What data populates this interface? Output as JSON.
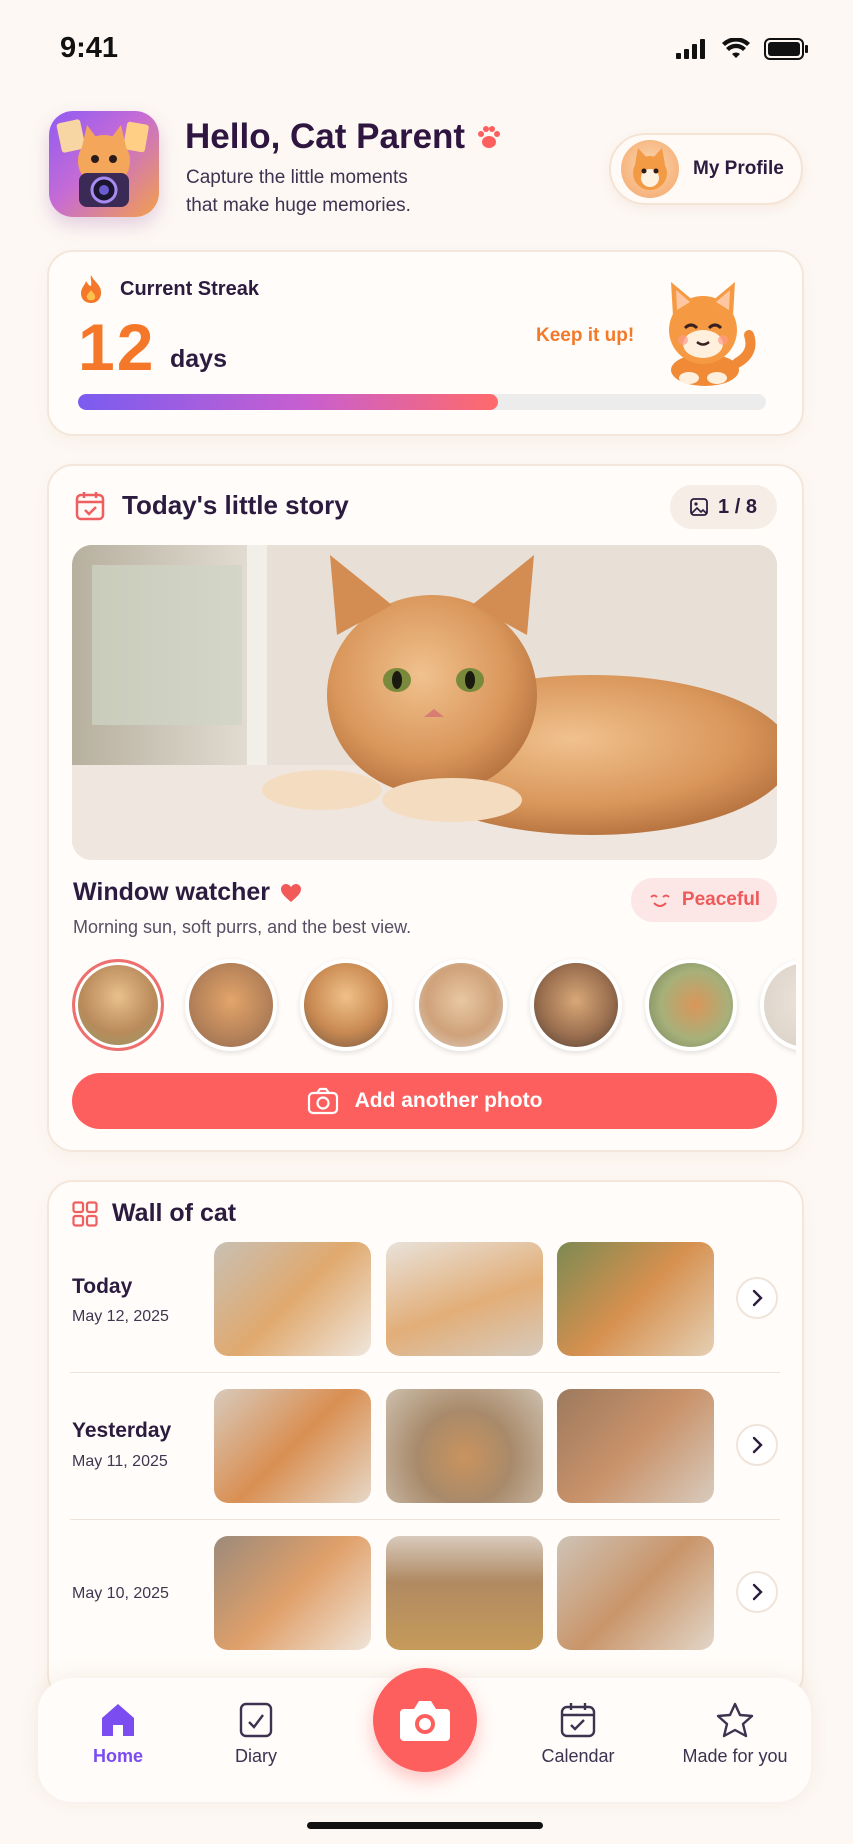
{
  "status": {
    "time": "9:41"
  },
  "header": {
    "title": "Hello, Cat Parent",
    "subtitle_line1": "Capture the little moments",
    "subtitle_line2": "that make huge memories.",
    "profile_label": "My Profile"
  },
  "streak": {
    "label": "Current Streak",
    "count": "12",
    "unit": "days",
    "encouragement": "Keep it up!",
    "progress": 0.61
  },
  "story": {
    "title": "Today's little story",
    "counter": "1 / 8",
    "photo_title": "Window watcher",
    "photo_caption": "Morning sun, soft purrs, and the best view.",
    "mood": "Peaceful",
    "add_button": "Add another photo"
  },
  "wall": {
    "title": "Wall of cat",
    "rows": [
      {
        "day": "Today",
        "date": "May 12, 2025"
      },
      {
        "day": "Yesterday",
        "date": "May 11, 2025"
      },
      {
        "day": "",
        "date": "May 10, 2025"
      }
    ]
  },
  "tabs": {
    "home": "Home",
    "diary": "Diary",
    "calendar": "Calendar",
    "made_for_you": "Made for you"
  },
  "colors": {
    "accent": "#fd5f5f",
    "streak_orange": "#f5782a",
    "active_tab": "#7b4cf0",
    "background": "#fdf8f4"
  }
}
